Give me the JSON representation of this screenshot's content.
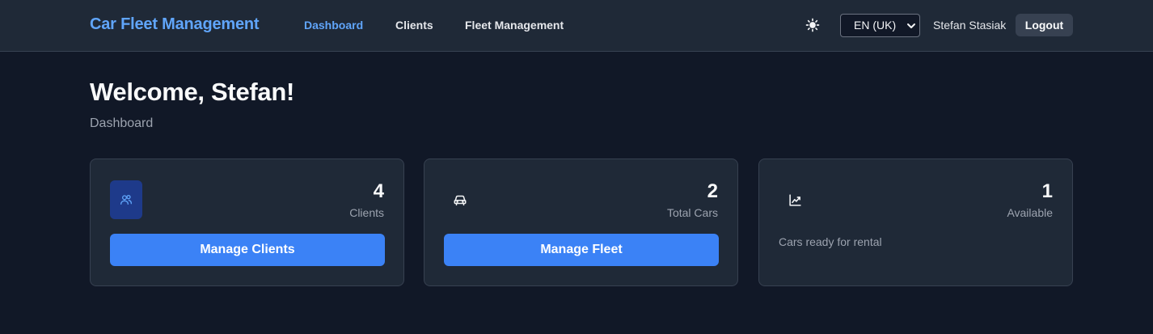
{
  "header": {
    "brand": "Car Fleet Management",
    "nav": [
      {
        "label": "Dashboard",
        "active": true
      },
      {
        "label": "Clients",
        "active": false
      },
      {
        "label": "Fleet Management",
        "active": false
      }
    ],
    "theme_icon": "sun-icon",
    "language": "EN (UK)",
    "username": "Stefan Stasiak",
    "logout_label": "Logout"
  },
  "page": {
    "welcome": "Welcome, Stefan!",
    "subtitle": "Dashboard"
  },
  "cards": [
    {
      "icon": "users-icon",
      "value": "4",
      "label": "Clients",
      "button": "Manage Clients"
    },
    {
      "icon": "car-icon",
      "value": "2",
      "label": "Total Cars",
      "button": "Manage Fleet"
    },
    {
      "icon": "chart-trending-icon",
      "value": "1",
      "label": "Available",
      "description": "Cars ready for rental"
    }
  ],
  "colors": {
    "background": "#111827",
    "surface": "#1f2937",
    "accent": "#3b82f6",
    "brand": "#60a5fa"
  }
}
